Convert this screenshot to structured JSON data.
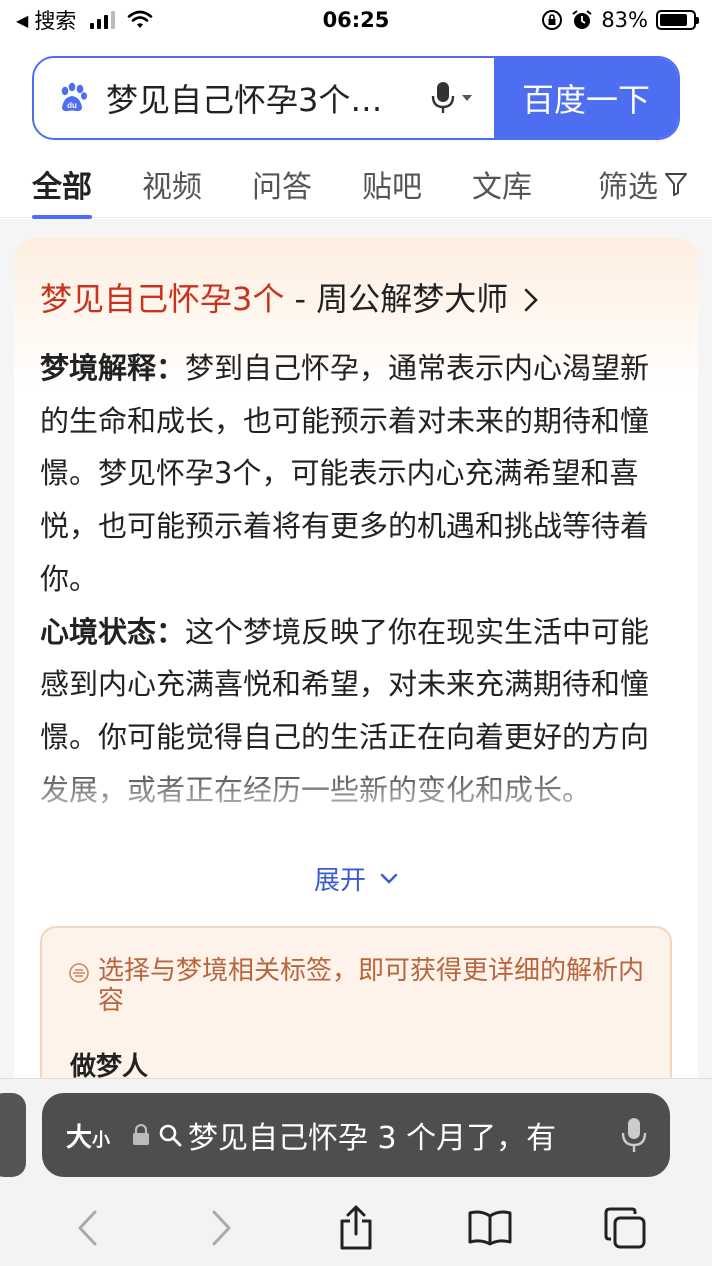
{
  "status_bar": {
    "back_app": "搜索",
    "time": "06:25",
    "battery": "83%",
    "battery_level": 0.83
  },
  "search": {
    "query": "梦见自己怀孕3个…",
    "button": "百度一下"
  },
  "tabs": [
    {
      "label": "全部",
      "active": true
    },
    {
      "label": "视频",
      "active": false
    },
    {
      "label": "问答",
      "active": false
    },
    {
      "label": "贴吧",
      "active": false
    },
    {
      "label": "文库",
      "active": false
    }
  ],
  "filter_label": "筛选",
  "result": {
    "title_highlight": "梦见自己怀孕3个",
    "title_rest": " - 周公解梦大师",
    "section1_label": "梦境解释：",
    "section1_text": "梦到自己怀孕，通常表示内心渴望新的生命和成长，也可能预示着对未来的期待和憧憬。梦见怀孕3个，可能表示内心充满希望和喜悦，也可能预示着将有更多的机遇和挑战等待着你。",
    "section2_label": "心境状态：",
    "section2_text": "这个梦境反映了你在现实生活中可能感到内心充满喜悦和希望，对未来充满期待和憧憬。你可能觉得自己的生活正在向着更好的方向发展，或者正在经历一些新的变化和成长。",
    "expand": "展开",
    "tag_hint": "选择与梦境相关标签，即可获得更详细的解析内容",
    "dreamer": "做梦人"
  },
  "safari": {
    "text_size": "大",
    "text_size_small": "小",
    "url": "梦见自己怀孕 3 个月了，有"
  },
  "colors": {
    "accent": "#4e6ef2",
    "title_red": "#c8331f",
    "hint_brown": "#b8663e"
  }
}
